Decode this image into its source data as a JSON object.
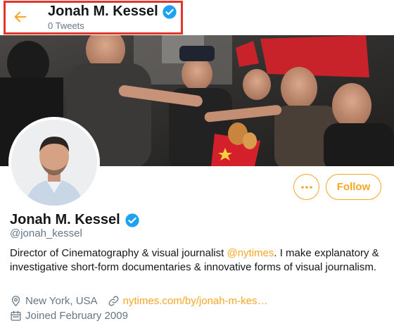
{
  "header": {
    "title": "Jonah M. Kessel",
    "tweet_count": "0 Tweets"
  },
  "profile": {
    "name": "Jonah M. Kessel",
    "handle": "@jonah_kessel",
    "bio_before": "Director of Cinematography & visual journalist ",
    "bio_mention": "@nytimes",
    "bio_after": ". I make explanatory & investigative short-form documentaries & innovative forms of visual journalism.",
    "location": "New York, USA",
    "website": "nytimes.com/by/jonah-m-kes…",
    "joined": "Joined February 2009"
  },
  "actions": {
    "more_label": "···",
    "follow_label": "Follow"
  },
  "colors": {
    "accent": "#f5a623",
    "verified": "#1da1f2",
    "highlight_box": "#e0362b"
  }
}
